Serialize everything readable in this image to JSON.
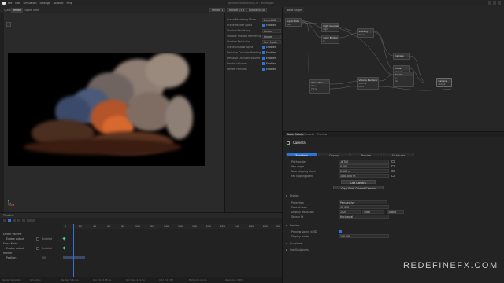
{
  "app": {
    "title": "generals/explosion01.ef - embergen",
    "menu": [
      "File",
      "Edit",
      "Simulation",
      "Settings",
      "Account",
      "Help"
    ]
  },
  "workspace": {
    "tabs": [
      "Quick",
      "Render",
      "Export",
      "Sims"
    ],
    "active_tab": "Render",
    "selectors": [
      "Render 1",
      "Render 01 ▾",
      "Enable in 3d"
    ]
  },
  "properties": {
    "rows": [
      {
        "label": "Scene Rendering Mode",
        "value": "Preset 06"
      },
      {
        "label": "Scene Render Alpha",
        "value": "Enabled"
      },
      {
        "label": "Shadow Rendering",
        "value": "Ignore"
      },
      {
        "label": "Shadow Shadow Rendering",
        "value": "Ignore"
      },
      {
        "label": "Shadow Resolution",
        "value": "Very Mode"
      },
      {
        "label": "Scene Shadow Alpha",
        "value": "Enabled"
      },
      {
        "label": "Emissive Occluder Padding",
        "value": "Enabled"
      },
      {
        "label": "Emissive Occluder Volume",
        "value": "Enabled"
      },
      {
        "label": "Render Volumes",
        "value": "Enabled"
      },
      {
        "label": "Render Particles",
        "value": "Enabled"
      }
    ]
  },
  "node_editor": {
    "title": "Node Graph",
    "nodes": [
      {
        "title": "Input Node",
        "ports": [
          "Sim",
          "Out"
        ]
      },
      {
        "title": "Light Generator",
        "ports": [
          "Light",
          "Output"
        ]
      },
      {
        "title": "Light Emitter",
        "ports": [
          "In",
          "Out"
        ]
      },
      {
        "title": "Color Emitter",
        "ports": [
          "In",
          "Out"
        ]
      },
      {
        "title": "Shading",
        "ports": [
          "Shade",
          "Ambient"
        ]
      },
      {
        "title": "Camera",
        "ports": [
          "Output"
        ]
      },
      {
        "title": "Simulation",
        "ports": [
          "Flow",
          "Force",
          "Shading"
        ]
      },
      {
        "title": "Volume Renderer",
        "ports": [
          "Volume",
          "Light",
          "Shading"
        ]
      },
      {
        "title": "Export",
        "ports": [
          "Output",
          "Cache"
        ]
      },
      {
        "title": "Render",
        "ports": [
          "In",
          "Out"
        ]
      },
      {
        "title": "Camera",
        "ports": [
          "Input",
          "Output"
        ]
      }
    ]
  },
  "attributes": {
    "tabs": [
      "Node Details",
      "Presets",
      "Preview"
    ],
    "active_tab": "Node Details",
    "node_name": "Camera",
    "sub_tabs": [
      "Transform",
      "Display",
      "Preview",
      "Sculptures"
    ],
    "active_sub_tab": "Transform",
    "rows": [
      {
        "label": "Pitch angle",
        "value": "-6.780"
      },
      {
        "label": "Yaw angle",
        "value": "0.000"
      },
      {
        "label": "Near clipping plane",
        "value": "0.100 m"
      },
      {
        "label": "Far clipping plane",
        "value": "1000.000 m"
      }
    ],
    "buttons": [
      "Use Camera",
      "Copy From Current Camera"
    ],
    "display_section": "Display",
    "display_rows": [
      {
        "label": "Projection",
        "value": "Perspective"
      },
      {
        "label": "Field of view",
        "value": "40.000"
      },
      {
        "label": "Display resolution",
        "value": "1920",
        "value2": "1080",
        "value3": "1080p"
      },
      {
        "label": "Sensor fit",
        "value": "Horizontal"
      }
    ],
    "preview_section": "Preview",
    "preview_rows": [
      {
        "label": "Preview sound in 3D",
        "value": ""
      },
      {
        "label": "Display mode",
        "value": "100.000"
      }
    ],
    "section3": "Sculptures",
    "section4": "Use Sculptures"
  },
  "timeline": {
    "title": "Timeline",
    "tracks": [
      {
        "name": "Ember Volume",
        "status": ""
      },
      {
        "name": "Enable output",
        "status": "Enabled"
      },
      {
        "name": "Force Noise",
        "status": ""
      },
      {
        "name": "Enable output",
        "status": "Enabled"
      },
      {
        "name": "Render",
        "status": ""
      },
      {
        "name": "Position",
        "status": "500"
      }
    ],
    "ruler": [
      "0",
      "20",
      "40",
      "60",
      "80",
      "100",
      "120",
      "140",
      "160",
      "180",
      "200",
      "220",
      "240",
      "260",
      "280",
      "300"
    ]
  },
  "statusbar": {
    "items": [
      "Render Simulation",
      "Simulation",
      "Render: 5.41 ms",
      "Sim Tick: 2.56 ms",
      "Sim Step: 4.19 ms",
      "GPU: 2.01 MB",
      "Memory: 1.21 GB",
      "Resolution: 800%"
    ]
  },
  "watermark": "REDEFINEFX.COM"
}
